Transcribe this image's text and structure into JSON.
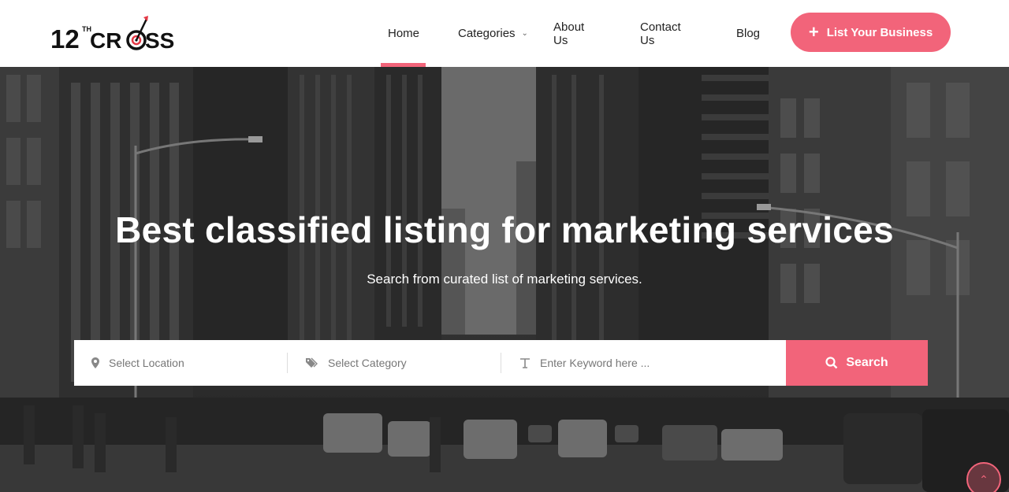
{
  "logo": {
    "number": "12",
    "superscript": "TH",
    "word": "CR",
    "word_end": "SS"
  },
  "nav": {
    "items": [
      {
        "label": "Home",
        "active": true
      },
      {
        "label": "Categories",
        "has_dropdown": true
      },
      {
        "label": "About Us"
      },
      {
        "label": "Contact Us"
      },
      {
        "label": "Blog"
      }
    ],
    "cta_label": "List Your Business"
  },
  "hero": {
    "title": "Best classified listing for marketing services",
    "subtitle": "Search from curated list of marketing services."
  },
  "search": {
    "location_placeholder": "Select Location",
    "category_placeholder": "Select Category",
    "keyword_placeholder": "Enter Keyword here ...",
    "button_label": "Search"
  },
  "icons": {
    "location": "map-pin-icon",
    "category": "tags-icon",
    "keyword": "text-icon",
    "search": "search-icon",
    "scroll_top": "chevron-up-icon"
  },
  "colors": {
    "accent": "#f2647a",
    "text": "#222222"
  }
}
